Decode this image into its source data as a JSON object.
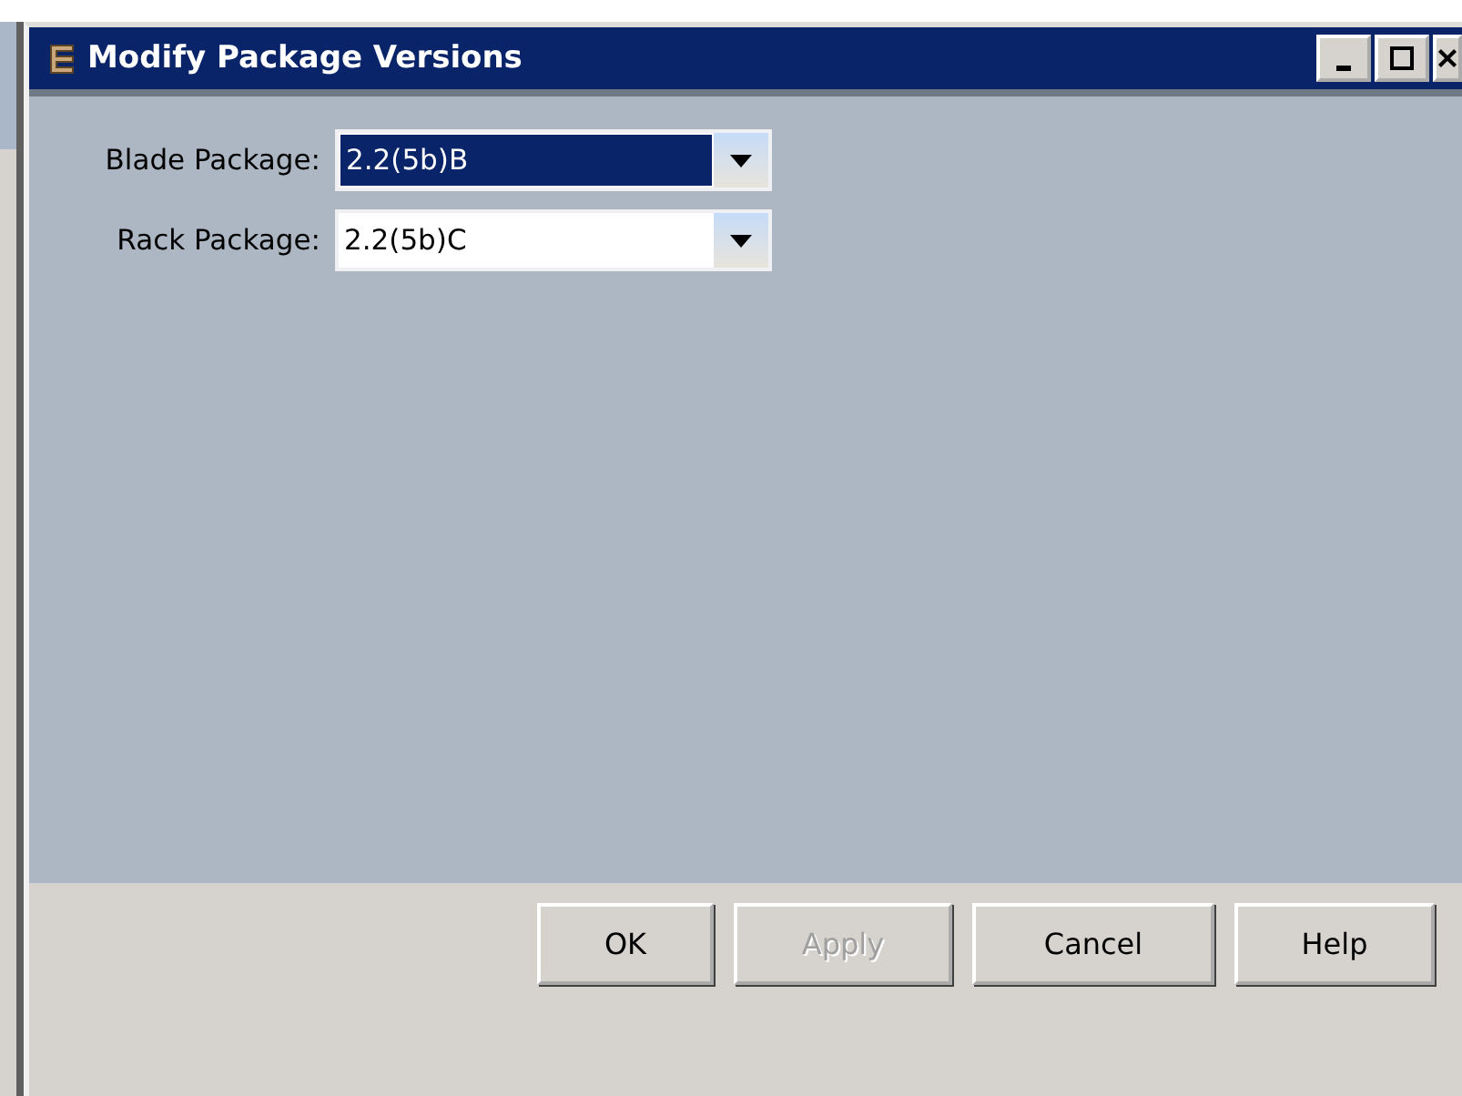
{
  "window": {
    "title": "Modify Package Versions"
  },
  "title_buttons": [
    {
      "kind": "minimize"
    },
    {
      "kind": "maximize"
    },
    {
      "kind": "close"
    }
  ],
  "fields": [
    {
      "label": "Blade Package:",
      "value": "2.2(5b)B",
      "selected": true
    },
    {
      "label": "Rack Package:",
      "value": "2.2(5b)C",
      "selected": false
    }
  ],
  "buttons": [
    {
      "label": "OK",
      "disabled": false
    },
    {
      "label": "Apply",
      "disabled": true
    },
    {
      "label": "Cancel",
      "disabled": false
    },
    {
      "label": "Help",
      "disabled": false
    }
  ]
}
